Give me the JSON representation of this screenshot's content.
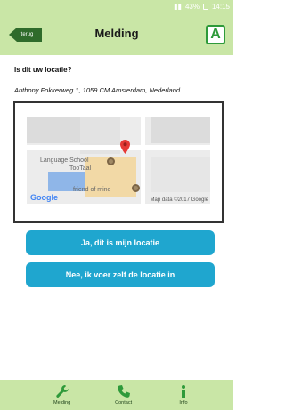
{
  "statusbar": {
    "battery": "43%",
    "time": "14:15"
  },
  "header": {
    "back_label": "terug",
    "title": "Melding",
    "logo_letter": "A"
  },
  "content": {
    "question": "Is dit uw locatie?",
    "address": "Anthony Fokkerweg 1, 1059 CM Amsterdam, Nederland"
  },
  "map": {
    "place_label_1": "Language School",
    "place_label_2": "TooTaal",
    "poi_label": "friend of mine",
    "brand": "Google",
    "attribution": "Map data ©2017 Google"
  },
  "buttons": {
    "confirm": "Ja, dit is mijn locatie",
    "manual": "Nee, ik voer zelf de locatie in"
  },
  "footer": {
    "tabs": [
      {
        "label": "Melding",
        "icon": "wrench-icon"
      },
      {
        "label": "Contact",
        "icon": "phone-icon"
      },
      {
        "label": "Info",
        "icon": "info-icon"
      }
    ]
  }
}
